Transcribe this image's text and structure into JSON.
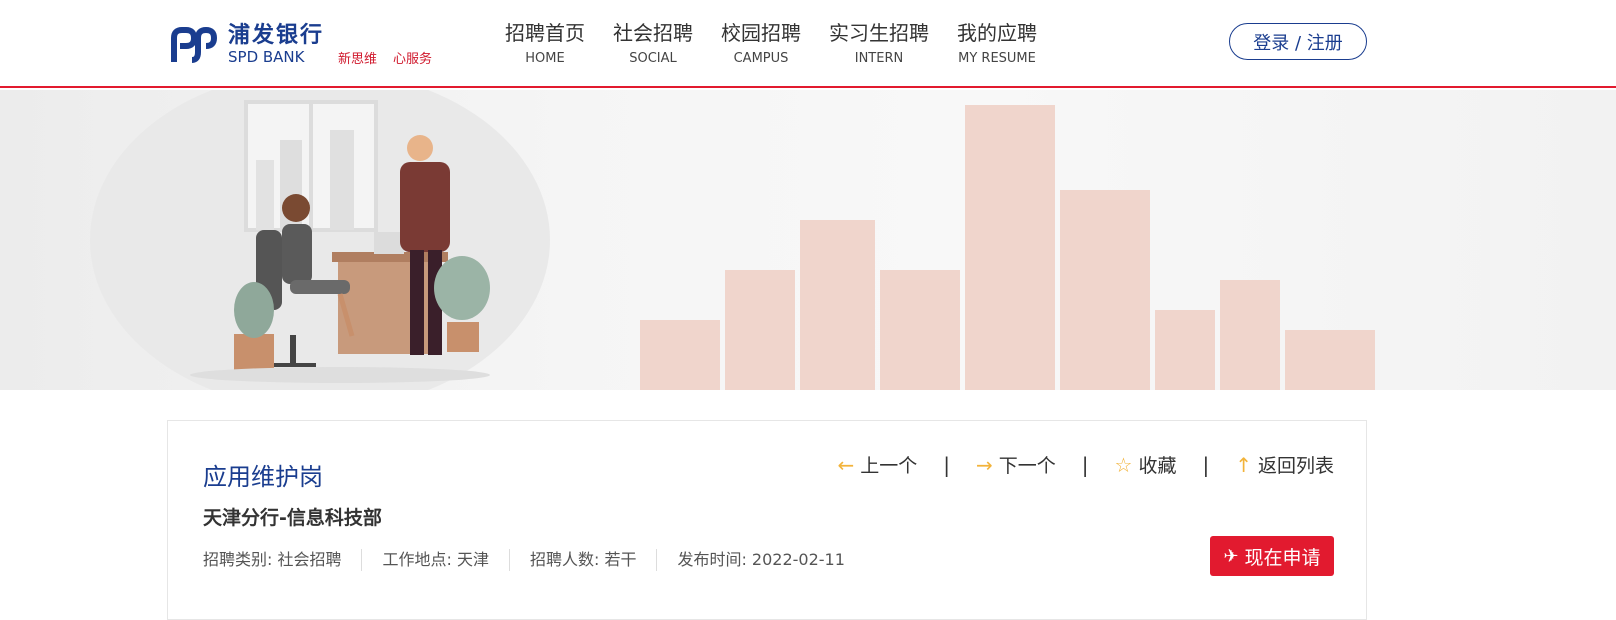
{
  "brand": {
    "name_cn": "浦发银行",
    "name_en": "SPD BANK",
    "slogan": [
      "新思维",
      "心服务"
    ],
    "color": "#1a3d8f",
    "accent": "#e21a2f"
  },
  "nav": [
    {
      "cn": "招聘首页",
      "en": "HOME"
    },
    {
      "cn": "社会招聘",
      "en": "SOCIAL"
    },
    {
      "cn": "校园招聘",
      "en": "CAMPUS"
    },
    {
      "cn": "实习生招聘",
      "en": "INTERN"
    },
    {
      "cn": "我的应聘",
      "en": "MY RESUME"
    }
  ],
  "login_label": "登录 / 注册",
  "job": {
    "title": "应用维护岗",
    "dept": "天津分行-信息科技部",
    "meta": [
      "招聘类别:  社会招聘",
      "工作地点:  天津",
      "招聘人数:  若干",
      "发布时间:  2022-02-11"
    ]
  },
  "actions": {
    "prev": "上一个",
    "next": "下一个",
    "favorite": "收藏",
    "back": "返回列表",
    "separator": "|"
  },
  "icons": {
    "prev": "arrow-left-icon",
    "next": "arrow-right-icon",
    "favorite": "star-icon",
    "back": "arrow-up-icon",
    "apply": "paper-plane-icon"
  },
  "apply_label": "现在申请"
}
